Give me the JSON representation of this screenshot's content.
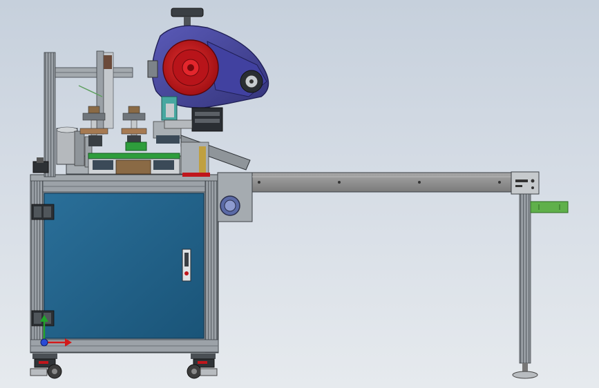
{
  "viewport": {
    "background_top": "#c6d0dc",
    "background_bottom": "#e6eaee"
  },
  "colors": {
    "frame_aluminum": "#9aa0a6",
    "cabinet_panel": "#1f5f86",
    "cabinet_frame": "#8b9299",
    "drive_housing": "#4a4aa0",
    "drive_hub": "#c0161c",
    "conveyor_rail": "#8c8c8c",
    "stop_block": "#5fb04a",
    "caster": "#3c3c3c",
    "pcb_green": "#2e9d3c",
    "wood_tone": "#8a6a45"
  },
  "triad": {
    "x_label": "",
    "y_label": "",
    "z_label": ""
  },
  "parts": {
    "main_frame": "aluminum-profile-frame",
    "cabinet": "blue-cabinet-door",
    "drive_unit": "label-drive-unit",
    "conveyor": "outfeed-conveyor-rail",
    "support_leg": "conveyor-support-leg",
    "casters": "locking-casters",
    "door_lock": "cabinet-door-lock"
  }
}
